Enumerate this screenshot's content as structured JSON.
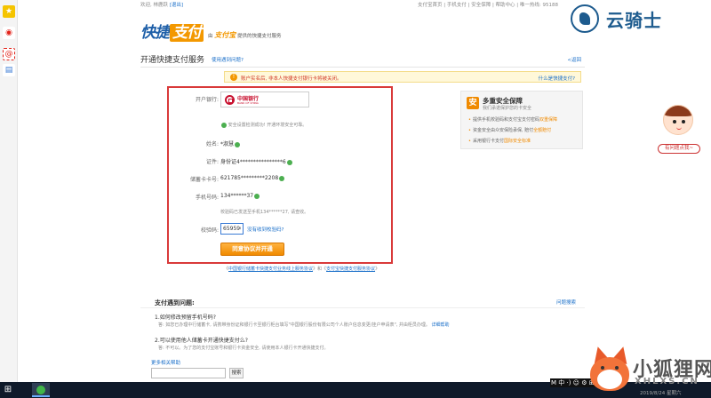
{
  "topbar": {
    "welcome": "欢迎, 林鹿跃",
    "logout": "[退出]",
    "links": "支付宝首页 | 手机支付 | 安全保障 | 帮助中心 | 唯一热线: 95188"
  },
  "header": {
    "logo_main": "快捷",
    "logo_accent": "支付",
    "logo_by": "由",
    "logo_brand": "支付宝",
    "logo_sub": "提供的快捷支付服务"
  },
  "watermark_top": {
    "text": "云骑士"
  },
  "page": {
    "title": "开通快捷支付服务",
    "help": "使用遇到问题?",
    "back": "<返回"
  },
  "notice": {
    "text": "账户实名后, 非本人快捷支付银行卡将被关闭。",
    "link": "什么是快捷支付?"
  },
  "form": {
    "bank_label": "开户银行:",
    "bank_name": "中国银行",
    "bank_name_en": "BANK OF CHINA",
    "security_msg": "安全设置检测成功! 开通环境安全可靠。",
    "name_label": "姓名:",
    "name_value": "*淑慧",
    "id_label": "证件:",
    "id_value": "身份证4****************6",
    "card_label": "储蓄卡卡号:",
    "card_value": "621785*********2208",
    "phone_label": "手机号码:",
    "phone_value": "134******37",
    "sms_msg": "校验码已发送至手机134******27, 请查收。",
    "code_label": "校验码:",
    "code_value": "659590",
    "code_resend": "没有收到校验码?",
    "submit_label": "同意协议并开通"
  },
  "agreement": {
    "prefix": "《",
    "link1": "中国银行储蓄卡快捷支付业务线上服务协议",
    "mid": "》和《",
    "link2": "支付宝快捷支付服务协议",
    "suffix": "》"
  },
  "security_panel": {
    "title": "多重安全保障",
    "subtitle": "我们承诺保护您的卡安全",
    "item1_prefix": "提供手机校验码和支付宝支付密码",
    "item1_hl": "双重保障",
    "item2_prefix": "资金安全由众安保险承保, 赔付",
    "item2_hl": "全额赔付",
    "item3_prefix": "采用银行卡支付",
    "item3_hl": "国际安全标准"
  },
  "assistant": {
    "ask_label": "有问题点我~"
  },
  "faq": {
    "header": "支付遇到问题:",
    "more": "问题搜索",
    "q1": "1.如何修改预留手机号码?",
    "a1": "答: 如您已办理中行储蓄卡, 请携带身份证和银行卡至银行柜台填写\"中国银行股份有限公司个人账户信息变更/挂户申请表\", 并由柜员办理。",
    "a1_link": "详细帮助",
    "q2": "2.可以使用他人储蓄卡开通快捷支付么?",
    "a2": "答: 不可以。为了您的支付宝账号和银行卡资金安全, 请使用本人银行卡开通快捷支付。",
    "search_label": "更多相关帮助",
    "search_btn": "搜索"
  },
  "watermark_bottom": {
    "text": "小狐狸网",
    "sub": "XHLXS.CN"
  },
  "taskbar": {
    "ime": "M 中 ·) ☺ ⚙ ⊞ ☺",
    "date": "2019/8/24 星期六"
  }
}
